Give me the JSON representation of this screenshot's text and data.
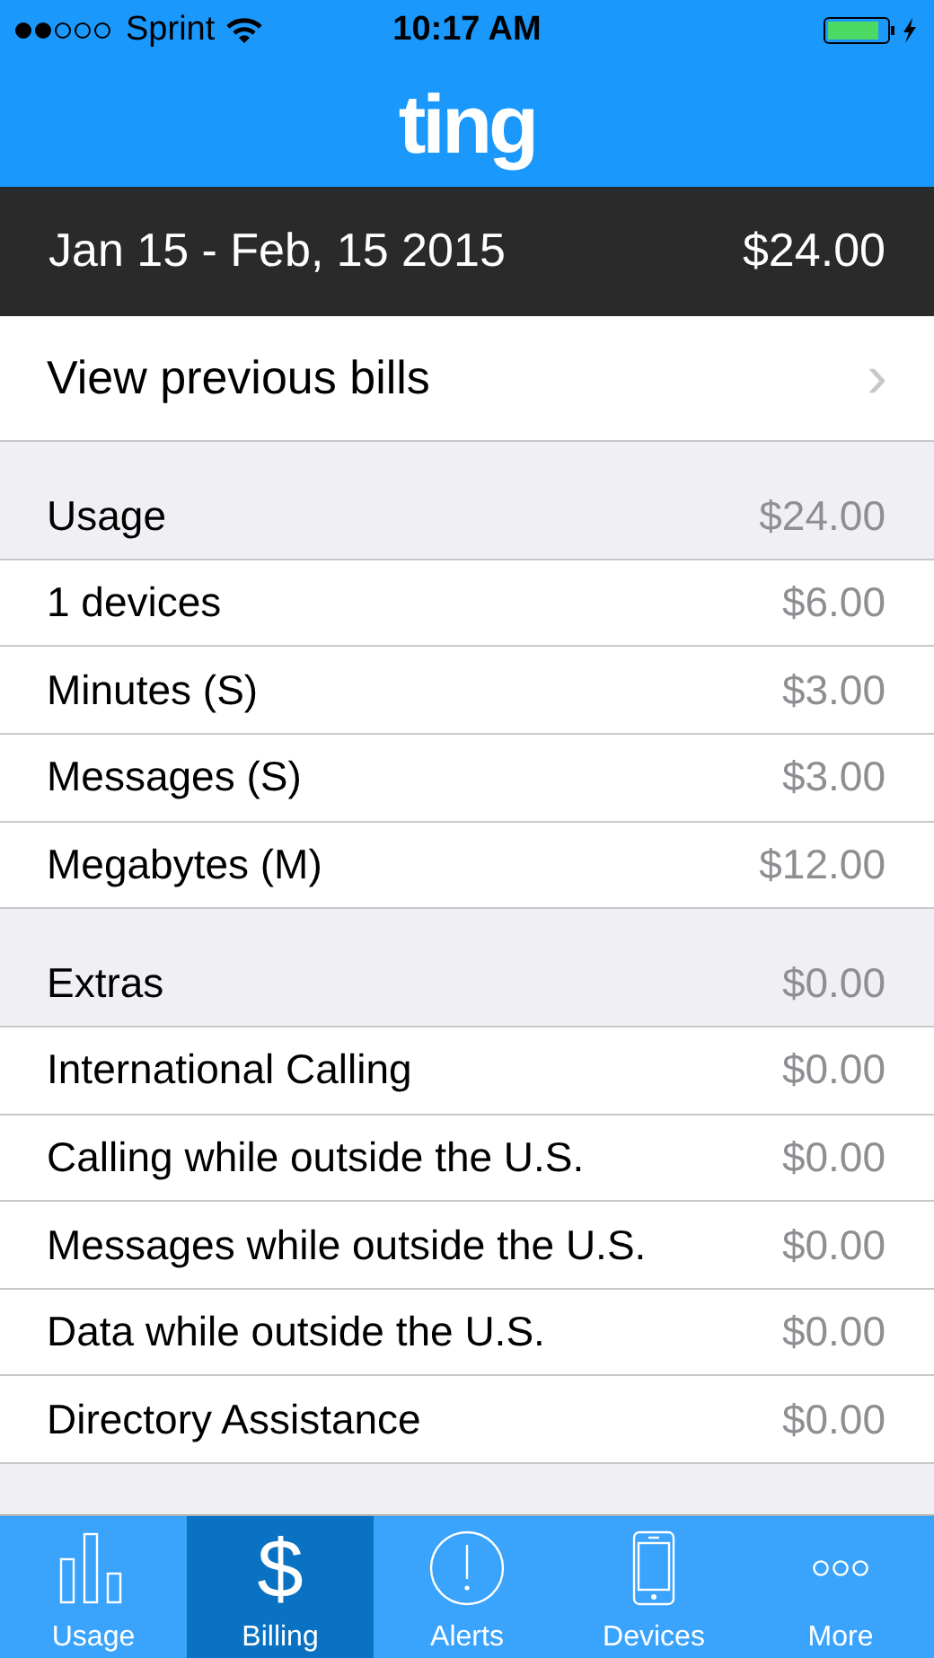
{
  "status_bar": {
    "carrier": "Sprint",
    "time": "10:17 AM"
  },
  "nav": {
    "logo": "ting"
  },
  "period": {
    "dates": "Jan 15 - Feb, 15 2015",
    "total": "$24.00"
  },
  "previous_bills": {
    "label": "View previous bills",
    "chevron": "›"
  },
  "sections": [
    {
      "title": "Usage",
      "amount": "$24.00",
      "rows": [
        {
          "label": "1 devices",
          "amount": "$6.00"
        },
        {
          "label": "Minutes (S)",
          "amount": "$3.00"
        },
        {
          "label": "Messages (S)",
          "amount": "$3.00"
        },
        {
          "label": "Megabytes (M)",
          "amount": "$12.00"
        }
      ]
    },
    {
      "title": "Extras",
      "amount": "$0.00",
      "rows": [
        {
          "label": "International Calling",
          "amount": "$0.00"
        },
        {
          "label": "Calling while outside the U.S.",
          "amount": "$0.00"
        },
        {
          "label": "Messages while outside the U.S.",
          "amount": "$0.00"
        },
        {
          "label": "Data while outside the U.S.",
          "amount": "$0.00"
        },
        {
          "label": "Directory Assistance",
          "amount": "$0.00"
        }
      ]
    }
  ],
  "tabs": [
    {
      "label": "Usage",
      "kind": "bars",
      "selected": false
    },
    {
      "label": "Billing",
      "kind": "glyph",
      "glyph": "$",
      "selected": true
    },
    {
      "label": "Alerts",
      "kind": "alert",
      "selected": false
    },
    {
      "label": "Devices",
      "kind": "phone",
      "selected": false
    },
    {
      "label": "More",
      "kind": "dots",
      "selected": false
    }
  ]
}
